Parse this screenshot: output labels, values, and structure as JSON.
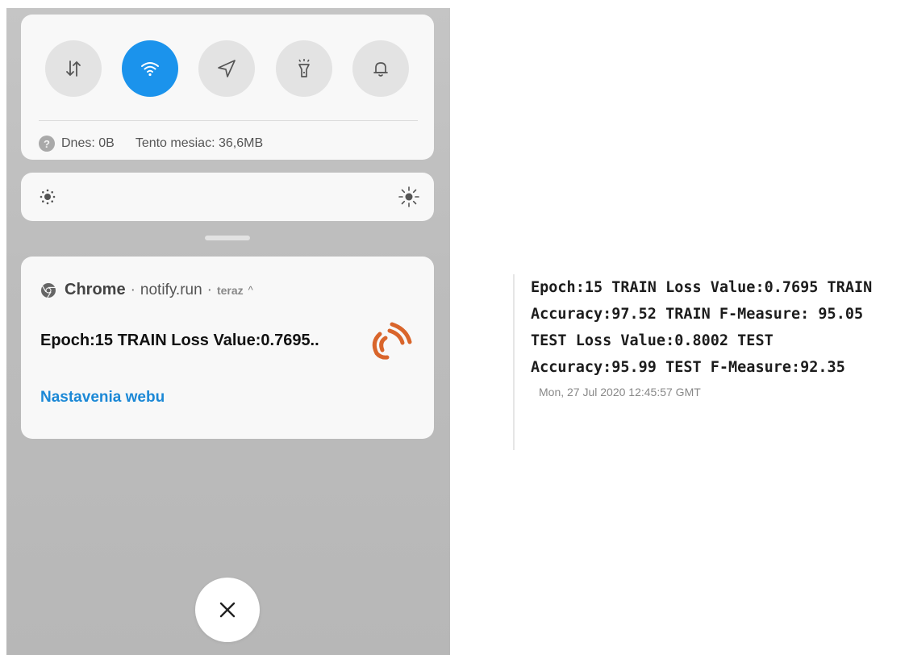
{
  "quick_settings": {
    "toggles": [
      {
        "name": "mobile-data",
        "icon": "data-arrows-icon",
        "active": false
      },
      {
        "name": "wifi",
        "icon": "wifi-icon",
        "active": true
      },
      {
        "name": "location",
        "icon": "location-arrow-icon",
        "active": false
      },
      {
        "name": "flashlight",
        "icon": "flashlight-icon",
        "active": false
      },
      {
        "name": "sound",
        "icon": "bell-icon",
        "active": false
      }
    ],
    "usage_help": "?",
    "usage_today": "Dnes: 0B",
    "usage_month": "Tento mesiac: 36,6MB",
    "active_color": "#1b93ec"
  },
  "brightness": {
    "low_icon": "brightness-low-icon",
    "high_icon": "brightness-high-icon"
  },
  "notification": {
    "app_name": "Chrome",
    "separator": "·",
    "domain": "notify.run",
    "time": "teraz",
    "expand_icon": "chevron-up-icon",
    "title": "Epoch:15 TRAIN Loss Value:0.7695..",
    "action": "Nastavenia webu",
    "action_color": "#1b88d6",
    "logo_color": "#d9652b"
  },
  "close_button": {
    "icon": "close-icon"
  },
  "message": {
    "text": "Epoch:15 TRAIN Loss Value:0.7695 TRAIN Accuracy:97.52 TRAIN F-Measure: 95.05 TEST Loss Value:0.8002 TEST Accuracy:95.99 TEST F-Measure:92.35",
    "timestamp": "Mon, 27 Jul 2020 12:45:57 GMT"
  }
}
